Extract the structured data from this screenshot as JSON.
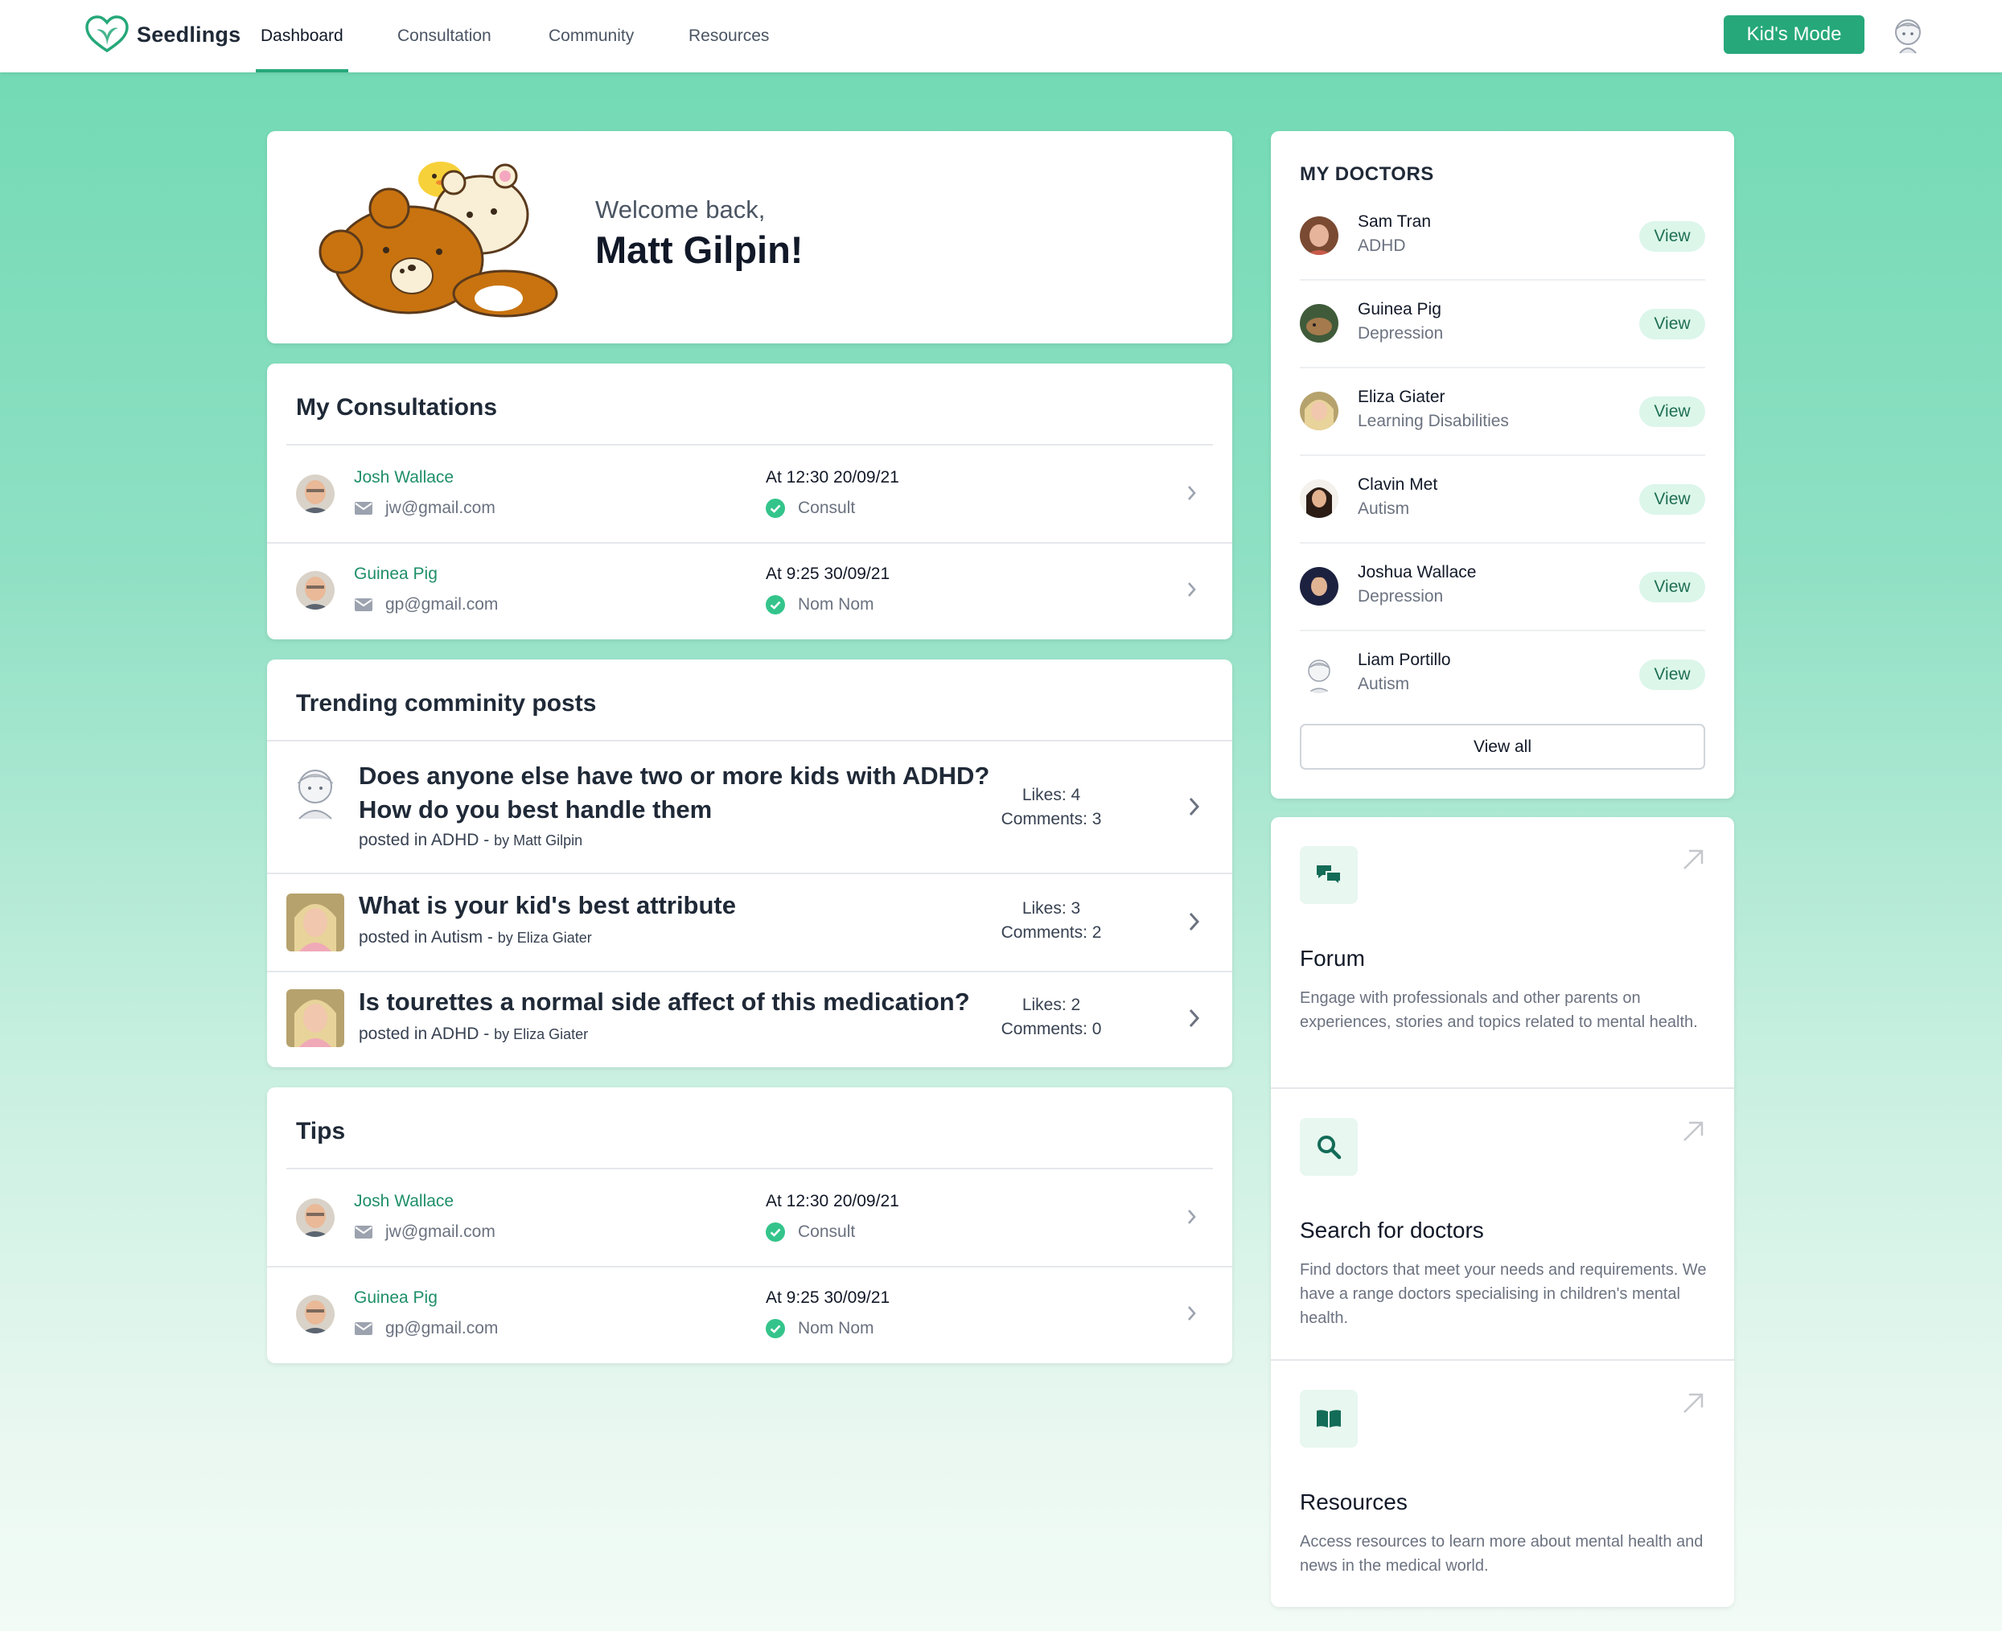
{
  "brand": {
    "name": "Seedlings",
    "accent": "#26a87a"
  },
  "nav": {
    "tabs": [
      {
        "label": "Dashboard"
      },
      {
        "label": "Consultation"
      },
      {
        "label": "Community"
      },
      {
        "label": "Resources"
      }
    ],
    "kids_mode_label": "Kid's Mode"
  },
  "welcome": {
    "greeting": "Welcome back,",
    "name": "Matt Gilpin!"
  },
  "consultations": {
    "title": "My Consultations",
    "rows": [
      {
        "name": "Josh Wallace",
        "email": "jw@gmail.com",
        "time": "At 12:30 20/09/21",
        "status": "Consult"
      },
      {
        "name": "Guinea Pig",
        "email": "gp@gmail.com",
        "time": "At 9:25 30/09/21",
        "status": "Nom Nom"
      }
    ]
  },
  "posts": {
    "title": "Trending comminity posts",
    "rows": [
      {
        "title_line1": "Does anyone else have two or more kids with ADHD?",
        "title_line2": "How do you best handle them",
        "posted_in": "posted in ADHD - ",
        "by": "by Matt Gilpin",
        "likes": "Likes: 4",
        "comments": "Comments: 3"
      },
      {
        "title_line1": "What is your kid's best attribute",
        "posted_in": "posted in Autism - ",
        "by": "by Eliza Giater",
        "likes": "Likes: 3",
        "comments": "Comments: 2"
      },
      {
        "title_line1": "Is tourettes a normal side affect of this medication?",
        "posted_in": "posted in ADHD - ",
        "by": "by Eliza Giater",
        "likes": "Likes: 2",
        "comments": "Comments: 0"
      }
    ]
  },
  "tips": {
    "title": "Tips",
    "rows": [
      {
        "name": "Josh Wallace",
        "email": "jw@gmail.com",
        "time": "At 12:30 20/09/21",
        "status": "Consult"
      },
      {
        "name": "Guinea Pig",
        "email": "gp@gmail.com",
        "time": "At 9:25 30/09/21",
        "status": "Nom Nom"
      }
    ]
  },
  "doctors": {
    "title": "MY DOCTORS",
    "view_label": "View",
    "view_all_label": "View all",
    "rows": [
      {
        "name": "Sam Tran",
        "specialty": "ADHD"
      },
      {
        "name": "Guinea Pig",
        "specialty": "Depression"
      },
      {
        "name": "Eliza Giater",
        "specialty": "Learning Disabilities"
      },
      {
        "name": "Clavin Met",
        "specialty": "Autism"
      },
      {
        "name": "Joshua Wallace",
        "specialty": "Depression"
      },
      {
        "name": "Liam Portillo",
        "specialty": "Autism"
      }
    ]
  },
  "features": [
    {
      "icon": "chat-bubbles-icon",
      "title": "Forum",
      "description": "Engage with professionals and other parents on experiences, stories and topics related to mental health."
    },
    {
      "icon": "search-icon",
      "title": "Search for doctors",
      "description": "Find doctors that meet your needs and requirements. We have a range doctors specialising in children's mental health."
    },
    {
      "icon": "open-book-icon",
      "title": "Resources",
      "description": "Access resources to learn more about mental health and news in the medical world."
    }
  ]
}
